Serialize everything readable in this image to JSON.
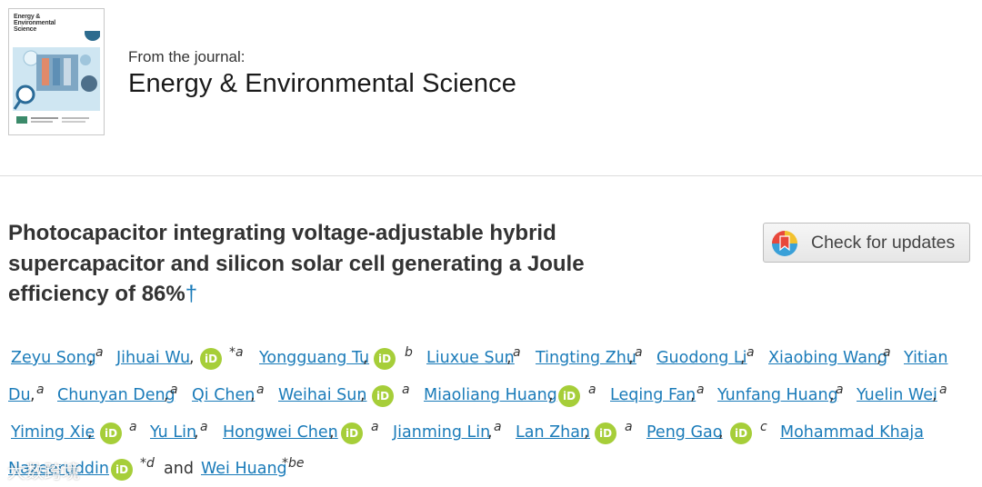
{
  "journal": {
    "cover_title_lines": [
      "Energy &",
      "Environmental",
      "Science"
    ],
    "from_label": "From the journal:",
    "name": "Energy & Environmental Science"
  },
  "article": {
    "title_lines": [
      "Photocapacitor integrating voltage-adjustable hybrid",
      "supercapacitor and silicon solar cell generating a Joule",
      "efficiency of 86%"
    ],
    "title_marker": "†"
  },
  "check_updates": {
    "label": "Check for updates"
  },
  "orcid_icon_text": "iD",
  "authors": {
    "line1": {
      "a1": "Zeyu Song",
      "p1": ",",
      "s1": "a",
      "a2": "Jihuai Wu",
      "p2": ",",
      "s2": "*a",
      "a3": "Yongguang Tu",
      "p3": ",",
      "s3": "b",
      "a4": "Liuxue Sun",
      "p4": ",",
      "s4": "a",
      "a5": "Tingting Zhu",
      "p5": ",",
      "s5": "a",
      "a6": "Guodong Li",
      "p6": ",",
      "s6": "a",
      "a7": "Xiaobing Wang",
      "p7": ",",
      "s7": "a",
      "a8": "Yitian"
    },
    "line2": {
      "a1": "Du",
      "p1": ",",
      "s1": "a",
      "a2": "Chunyan Deng",
      "p2": ",",
      "s2": "a",
      "a3": "Qi Chen",
      "p3": ",",
      "s3": "a",
      "a4": "Weihai Sun",
      "p4": ",",
      "s4": "a",
      "a5": "Miaoliang Huang",
      "p5": ",",
      "s5": "a",
      "a6": "Leqing Fan",
      "p6": ",",
      "s6": "a",
      "a7": "Yunfang Huang",
      "p7": ",",
      "s7": "a",
      "a8": "Yuelin Wei",
      "p8": ",",
      "s8": "a"
    },
    "line3": {
      "a1": "Yiming Xie",
      "p1": ",",
      "s1": "a",
      "a2": "Yu Lin",
      "p2": ",",
      "s2": "a",
      "a3": "Hongwei Chen",
      "p3": ",",
      "s3": "a",
      "a4": "Jianming Lin",
      "p4": ",",
      "s4": "a",
      "a5": "Lan Zhan",
      "p5": ",",
      "s5": "a",
      "a6": "Peng Gao",
      "p6": ",",
      "s6": "c",
      "a7": "Mohammad Khaja"
    },
    "line4": {
      "a1": "Nazeeruddin",
      "s1": "*d",
      "and": "and",
      "a2": "Wei Huang",
      "s2": "*be"
    }
  },
  "watermark": "大数跨境",
  "colors": {
    "link": "#1a7bb9",
    "orcid": "#a6ce39",
    "title": "#333333"
  }
}
